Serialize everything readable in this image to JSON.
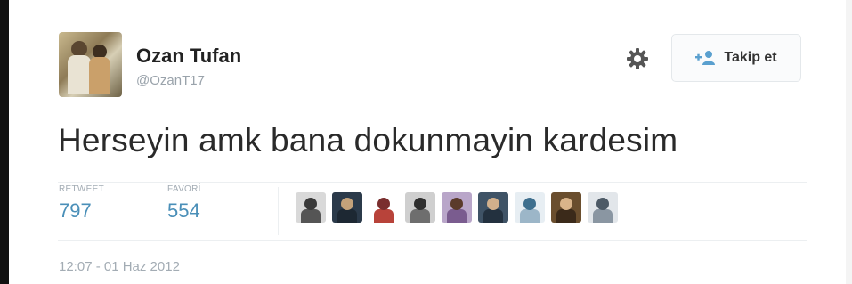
{
  "tweet": {
    "author_name": "Ozan Tufan",
    "author_handle": "@OzanT17",
    "text": "Herseyin amk bana dokunmayin kardesim",
    "timestamp": "12:07 - 01 Haz 2012"
  },
  "actions": {
    "follow_label": "Takip et",
    "settings_icon": "gear-icon",
    "follow_icon": "add-user-icon"
  },
  "stats": {
    "retweet_label": "RETWEET",
    "retweet_count": "797",
    "favorite_label": "FAVORİ",
    "favorite_count": "554"
  },
  "favoriters": [
    {
      "bg": "#d9d9d9",
      "head": "#3a3a3a",
      "body": "#555555"
    },
    {
      "bg": "#2b3a4a",
      "head": "#c4a27a",
      "body": "#1d2833"
    },
    {
      "bg": "#ffffff",
      "head": "#7a2e2e",
      "body": "#b8433a"
    },
    {
      "bg": "#cfcfcf",
      "head": "#2f2f2f",
      "body": "#6e6e6e"
    },
    {
      "bg": "#b9a6c9",
      "head": "#5b3b2b",
      "body": "#7a5c8f"
    },
    {
      "bg": "#3f5366",
      "head": "#d2b08c",
      "body": "#23313f"
    },
    {
      "bg": "#e7eef3",
      "head": "#3e6f8e",
      "body": "#9cb6c8"
    },
    {
      "bg": "#6a4e2e",
      "head": "#d9b48a",
      "body": "#3b2a1a"
    },
    {
      "bg": "#e2e6ea",
      "head": "#4d5a66",
      "body": "#8a96a2"
    }
  ],
  "colors": {
    "stat_value": "#4a8fb8",
    "muted": "#a3acb4"
  }
}
